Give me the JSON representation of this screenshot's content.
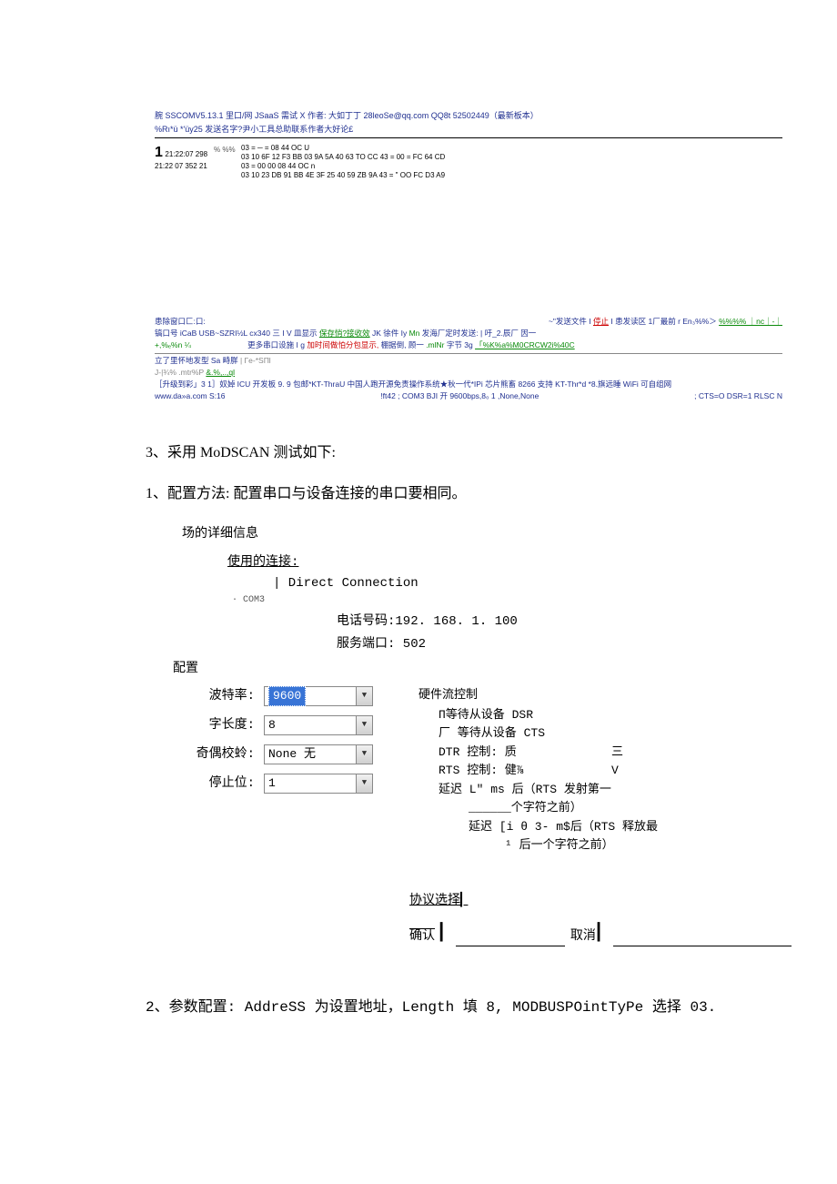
{
  "sscom": {
    "title": "腕  SSCOMV5.13.1 里口/网 JSaaS 需试 X 作者: 大如丁丁 28leoSe@qq.com QQ8t 52502449（最新板本）",
    "sub": "%Rı*ü *'üy25 发送名字?尹小工具总助联系作者大好论£",
    "ts_big": "1",
    "ts1": "21:22:07 298",
    "ts2": "21:22 07 352 21",
    "pct": "% %%",
    "hex": [
      "03 = ─ = 08 44 OC U",
      "03 10 6F 12 F3 BB 03 9A 5A 40 63 TO CC 43 = 00 = FC 64 CD",
      "03 = 00 00 08 44 OC n",
      "03 10 23 DB 91 BB 4E 3F 25 40 59 ZB 9A 43 = \" OO FC D3 A9"
    ],
    "lower": {
      "a1_left": "患除窗口匚:口:",
      "a1_right_pre": "~\"发送文件 I ",
      "a1_stop": "停止",
      "a1_mid": " I 患发读区 1厂最前 r En₃%%＞ ",
      "a1_tail": "%%%% ｜nc｜-｜",
      "a2_left": "镐口号 iCaB USB~SZRI½L cx340",
      "a2_mid_a": "    三 I V 皿显示  ",
      "a2_save": "保存悄?接收效",
      "a2_mid_b": " JK 徐件 Iy ",
      "a2_mn": "Mn",
      "a2_mid_c": " 发海厂定时发送: | 吁_2.辰厂   因一",
      "a3_left": "+,%ₑ%n ¼",
      "a3_mid_a": "更多串口设施 I g ",
      "a3_more": "加时间做怕分包显示,",
      "a3_mid_b": " 棚据倒,  顾一 ",
      "a3_mid_c": " 字节 3g  ",
      "a3_tail": "「%K%a%M0CRCW2i%40C",
      "a3_mlnr": ".mlNr",
      "a4_a": "立了里怀地发型 Sa 畤羘  ",
      "a4_b": "| Гe-*SПl",
      "a5_a": "J-|¾%  .mtr%P ",
      "a5_b": "&.%,..,ql",
      "a6": "［升级到彩」3 1］奴婥  ICU 开发板 9. 9 包邮*KT-ThraU 中国人跑开源免责操作系统★秋一代*IPi 芯片熊畜 8266 支持 KT-Thr*d *8.旗远睡 WiFi 可自组网",
      "a7_left": "www.da»a.com S:16",
      "a7_mid": "!ft42 ;   COM3 BJI 开   9600bps,8₀ 1 ,None,None",
      "a7_right": ";   CTS=O DSR=1 RLSC N"
    }
  },
  "body1": "3、采用 MoDSCAN 测试如下:",
  "body2": "1、配置方法: 配置串口与设备连接的串口要相同。",
  "dialog": {
    "title": "场的详细信息",
    "conn_label": "使用的连接:",
    "conn_val": "| Direct Connection",
    "com": "·   COM3",
    "phone_label": "电话号码:",
    "phone_val": "192. 168. 1. 100",
    "port_label": "服务端口:",
    "port_val": "  502",
    "conf_hdr": "配置",
    "left": {
      "baud_l": "波特率:",
      "baud_v": "9600",
      "len_l": "字长度:",
      "len_v": "8",
      "par_l": "奇偶校蛉:",
      "par_v": "None 无",
      "stop_l": "停止位:",
      "stop_v": "1"
    },
    "right": {
      "hdr": "硬件流控制",
      "r1": "П等待从设备 DSR",
      "r2": "厂 等待从设备 CTS",
      "r3_k": "DTR 控制: 质",
      "r3_v": "三",
      "r4_k": "RTS 控制: 健⅞",
      "r4_v": "V",
      "r5": "延迟 L\" ms 后（RTS 发射第一",
      "r5b": "______个字符之前）",
      "r6": "延迟 [i θ 3- m$后（RTS 释放最",
      "r6b": "¹ 后一个字符之前）"
    },
    "proto": "协议选择",
    "ok": "确认",
    "cancel": "取消"
  },
  "body3": "2、参数配置: AddreSS 为设置地址，Length 填 8, MODBUSPOintTyPe 选择 03."
}
